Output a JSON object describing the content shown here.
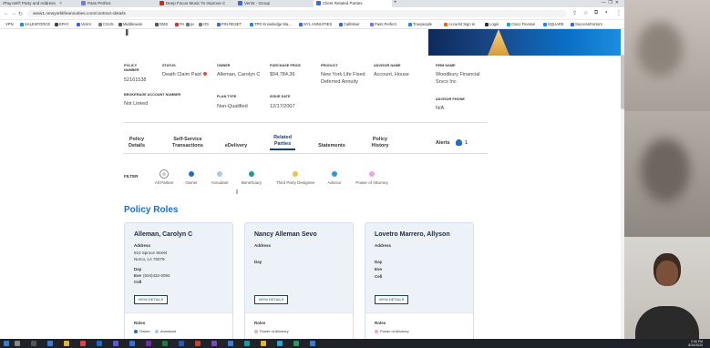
{
  "browser": {
    "tabs": [
      {
        "label": "rPay.net® Party and Address",
        "icon_color": "#6b7fd7"
      },
      {
        "label": "Pass Perfect",
        "icon_color": "#6b7fd7"
      },
      {
        "label": "Deep Focus Music To Improve C",
        "icon_color": "#e62117"
      },
      {
        "label": "Verint - Group",
        "icon_color": "#2f6fd6"
      },
      {
        "label": "Client Related Parties",
        "icon_color": "#2f6fd6"
      }
    ],
    "url": "www1.newyorklifeannuities.com/contract-details",
    "bookmarks": [
      "VPN",
      "SALESFORCE",
      "EPAY",
      "Verint",
      "CSUS",
      "Middleware",
      "DMS",
      "PA",
      "pc",
      "OS",
      "PIN RESET",
      "TPD Knowledge Ma...",
      "NYL ANNUITIES",
      "CallMiner",
      "Pass Perfect",
      "Truepeople",
      "Accurint Sign In",
      "Login",
      "Cisco Finesse",
      "SQUARE",
      "SuccessFactors"
    ]
  },
  "policy": {
    "labels": {
      "policy_number": "POLICY NUMBER",
      "status": "STATUS",
      "owner": "OWNER",
      "purchase_price": "PURCHASE PRICE",
      "product": "PRODUCT",
      "advisor_name": "ADVISOR NAME",
      "firm_name": "FIRM NAME",
      "brokerage": "BROKERAGE ACCOUNT NUMBER",
      "plan_type": "PLAN TYPE",
      "issue_date": "ISSUE DATE",
      "advisor_phone": "ADVISOR PHONE"
    },
    "policy_number": "52161538",
    "status": "Death Claim Paid",
    "owner": "Alleman, Carolyn C",
    "purchase_price": "$94,784.36",
    "product": "New York Life Fixed Deferred Annuity",
    "advisor_name": "Account, House",
    "firm_name": "Woodbury Financial Srvcs Inc",
    "brokerage": "Not Linked",
    "plan_type": "Non-Qualified",
    "issue_date": "12/17/2007",
    "advisor_phone": "N/A"
  },
  "nav_tabs": [
    "Policy Details",
    "Self-Service Transactions",
    "eDelivery",
    "Related Parties",
    "Statements",
    "Policy History"
  ],
  "alerts": {
    "label": "Alerts",
    "count": "1"
  },
  "filter": {
    "label": "FILTER",
    "options": [
      {
        "label": "All Parties",
        "color": "#cccccc"
      },
      {
        "label": "Owner",
        "color": "#1e6fc2"
      },
      {
        "label": "Annuitant",
        "color": "#a9cbe9"
      },
      {
        "label": "Beneficiary",
        "color": "#1f9c8c"
      },
      {
        "label": "Third Party Designee",
        "color": "#f0c24a"
      },
      {
        "label": "Advisor",
        "color": "#2a9bd6"
      },
      {
        "label": "Power of Attorney",
        "color": "#e9a6e0"
      }
    ]
  },
  "section_title": "Policy Roles",
  "cards": [
    {
      "name": "Alleman, Carolyn C",
      "address_label": "Address",
      "address_lines": [
        "510 Spruce Street",
        "Norco, LA 70079"
      ],
      "day_label": "Day",
      "eve_label": "Eve",
      "eve_value": "(504)432-0092",
      "cell_label": "Cell",
      "button": "VIEW DETAILS",
      "roles_label": "Roles",
      "roles": [
        {
          "label": "Owner",
          "color": "#1e6fc2"
        },
        {
          "label": "Annuitant",
          "color": "#a9cbe9"
        }
      ]
    },
    {
      "name": "Nancy Alleman Sevo",
      "address_label": "Address",
      "day_label": "Day",
      "button": "VIEW DETAILS",
      "roles_label": "Roles",
      "roles": [
        {
          "label": "Power of Attorney",
          "color": "#e9a6e0"
        }
      ]
    },
    {
      "name": "Lovetro Marrero, Allyson",
      "address_label": "Address",
      "day_label": "Day",
      "eve_label": "Eve",
      "cell_label": "Cell",
      "button": "VIEW DETAILS",
      "roles_label": "Roles",
      "roles": [
        {
          "label": "Power of Attorney",
          "color": "#e9a6e0"
        }
      ]
    }
  ],
  "taskbar": {
    "time": "2:36 PM",
    "date": "8/24/2023"
  }
}
